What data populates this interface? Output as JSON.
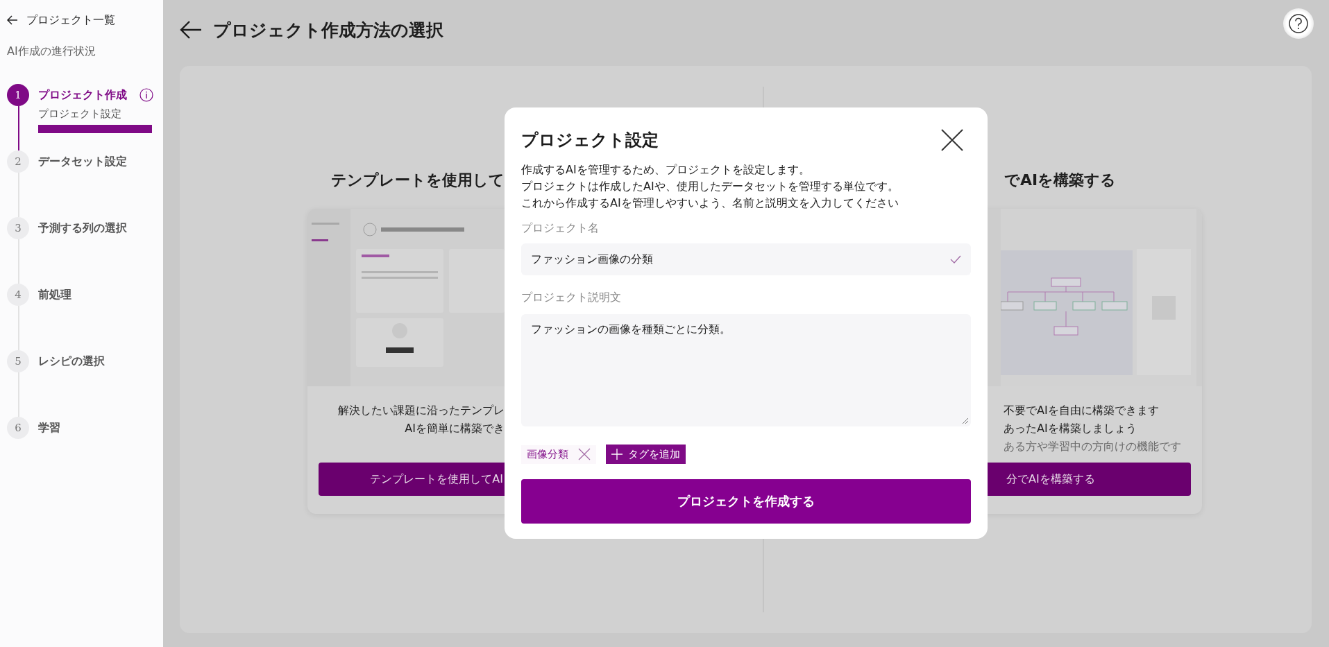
{
  "sidebar": {
    "back_link": "プロジェクト一覧",
    "progress_title": "AI作成の進行状況",
    "steps": [
      {
        "number": "1",
        "label": "プロジェクト作成",
        "selected": true,
        "info": true,
        "substep": {
          "label": "プロジェクト設定",
          "level": 1
        }
      },
      {
        "number": "2",
        "label": "データセット設定",
        "selected": false,
        "info": false
      },
      {
        "number": "3",
        "label": "予測する列の選択",
        "selected": false,
        "info": false
      },
      {
        "number": "4",
        "label": "前処理",
        "selected": false,
        "info": false
      },
      {
        "number": "5",
        "label": "レシピの選択",
        "selected": false,
        "info": false
      },
      {
        "number": "6",
        "label": "学習",
        "selected": false,
        "info": false
      }
    ]
  },
  "page": {
    "title": "プロジェクト作成方法の選択"
  },
  "options": [
    {
      "title": "テンプレートを使用して",
      "description": [
        {
          "text": "解決したい課題に沿ったテンプレ",
          "muted": false
        },
        {
          "text": "AIを簡単に構築でき",
          "muted": false
        }
      ],
      "button": "テンプレートを使用してAI"
    },
    {
      "title": "でAIを構築する",
      "description": [
        {
          "text": "不要でAIを自由に構築できます",
          "muted": false
        },
        {
          "text": "あったAIを構築しましょう",
          "muted": false
        },
        {
          "text": "ある方や学習中の方向けの機能です",
          "muted": true
        }
      ],
      "button": "分でAIを構築する"
    }
  ],
  "dialog": {
    "title": "プロジェクト設定",
    "intro": [
      "作成するAIを管理するため、プロジェクトを設定します。",
      "プロジェクトは作成したAIや、使用したデータセットを管理する単位です。",
      "これから作成するAIを管理しやすいよう、名前と説明文を入力してください"
    ],
    "name_field": {
      "label": "プロジェクト名",
      "value": "ファッション画像の分類",
      "valid": true
    },
    "description_field": {
      "label": "プロジェクト説明文",
      "value": "ファッションの画像を種類ごとに分類。"
    },
    "tags": [
      {
        "label": "画像分類"
      }
    ],
    "add_tag_button": "タグを追加",
    "submit_button": "プロジェクトを作成する"
  }
}
